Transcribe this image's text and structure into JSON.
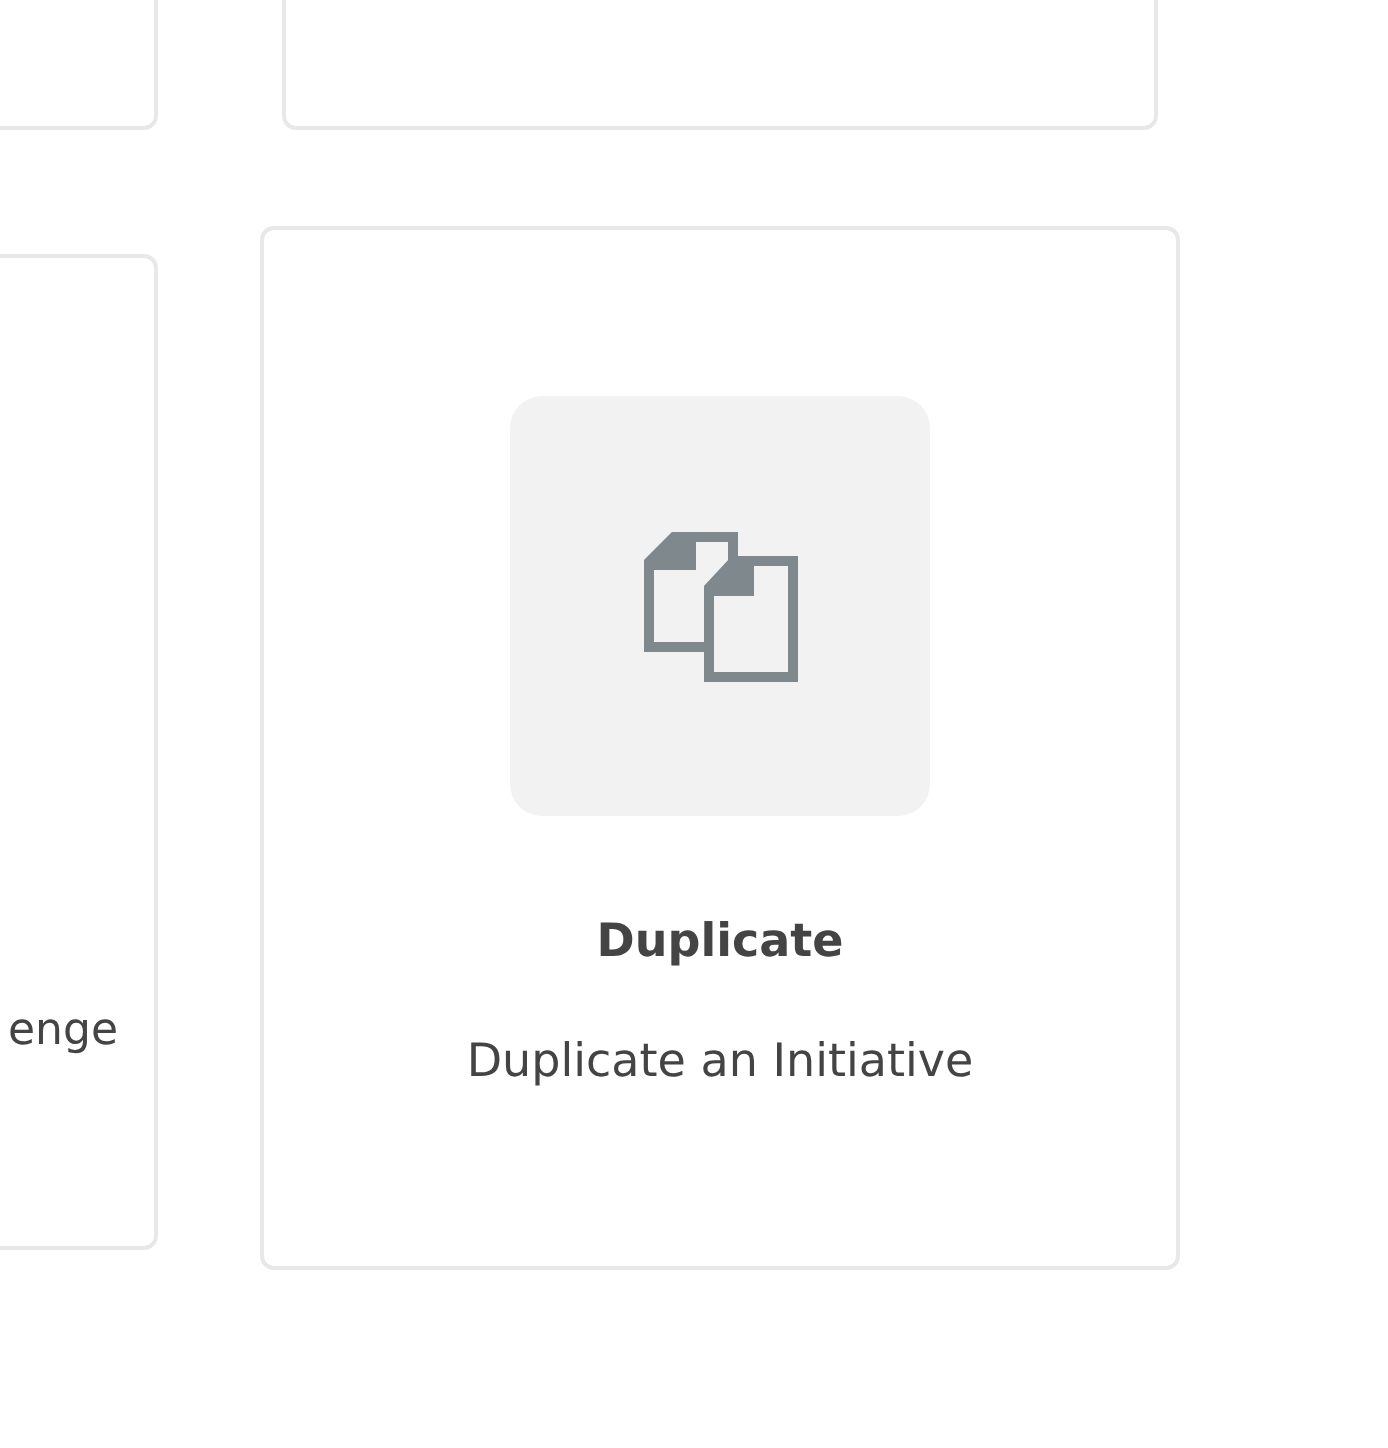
{
  "cards": [
    {
      "kind": "partial"
    },
    {
      "kind": "partial"
    },
    {
      "kind": "partial",
      "description": "enge"
    },
    {
      "kind": "action",
      "title": "Duplicate",
      "description": "Duplicate an Initiative"
    }
  ]
}
